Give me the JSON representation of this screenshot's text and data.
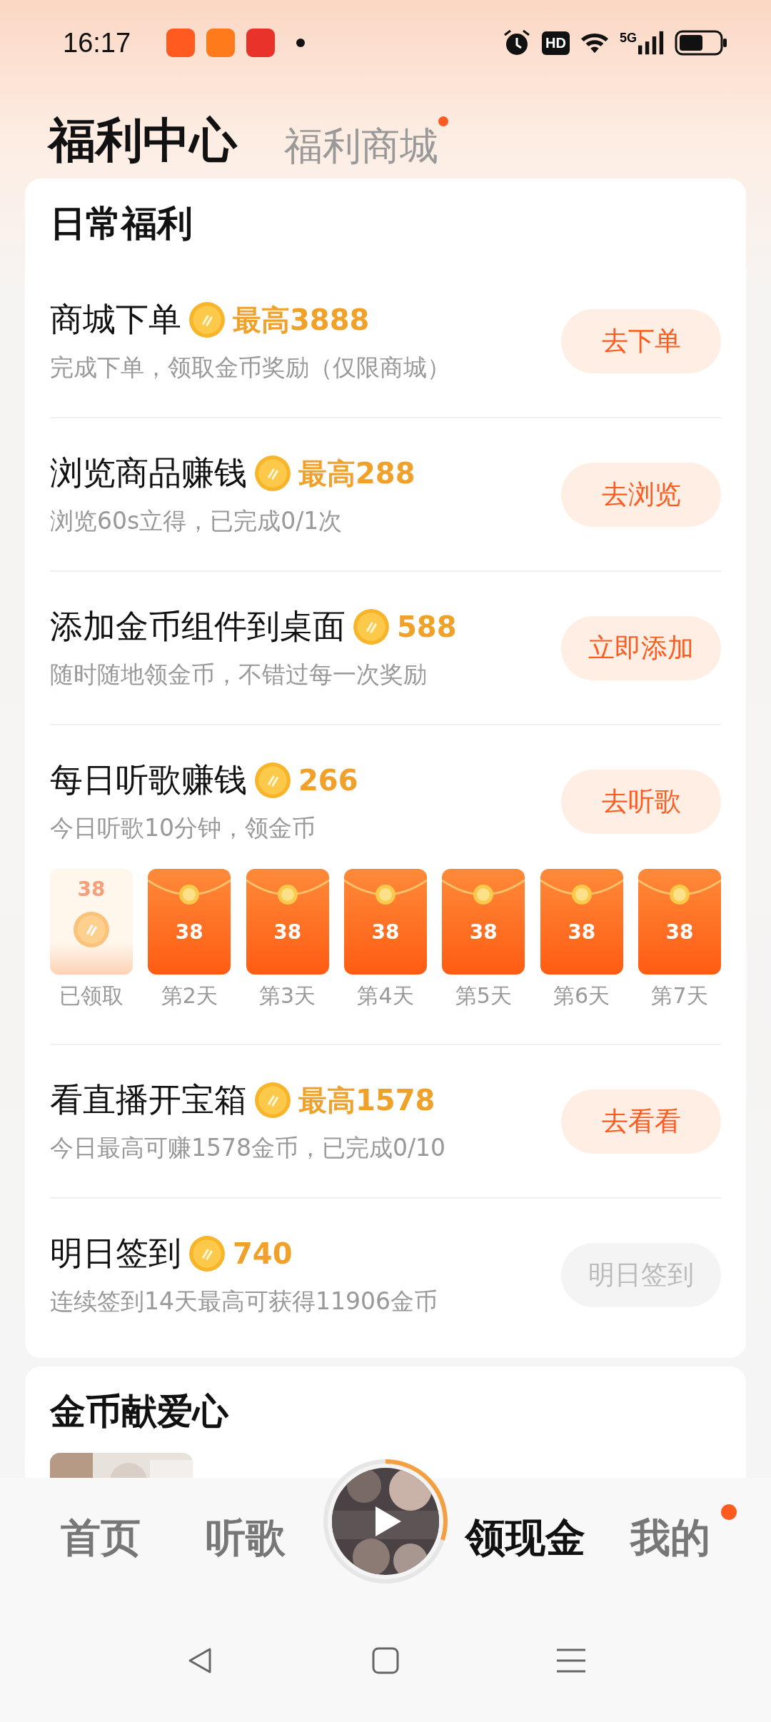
{
  "status_bar": {
    "time": "16:17",
    "notification_apps": [
      {
        "color": "#ff5a1f"
      },
      {
        "color": "#ff7a1a"
      },
      {
        "color": "#e8322a"
      }
    ],
    "hd": "HD",
    "network": "5G"
  },
  "tabs": [
    {
      "label": "福利中心",
      "selected": true,
      "badge": false
    },
    {
      "label": "福利商城",
      "selected": false,
      "badge": true
    }
  ],
  "daily": {
    "title": "日常福利",
    "tasks": [
      {
        "title": "商城下单",
        "reward": "最高3888",
        "subtitle": "完成下单，领取金币奖励（仅限商城）",
        "button": "去下单",
        "disabled": false
      },
      {
        "title": "浏览商品赚钱",
        "reward": "最高288",
        "subtitle": "浏览60s立得，已完成0/1次",
        "button": "去浏览",
        "disabled": false
      },
      {
        "title": "添加金币组件到桌面",
        "reward": "588",
        "subtitle": "随时随地领金币，不错过每一次奖励",
        "button": "立即添加",
        "disabled": false
      },
      {
        "title": "每日听歌赚钱",
        "reward": "266",
        "subtitle": "今日听歌10分钟，领金币",
        "button": "去听歌",
        "disabled": false,
        "packets": [
          {
            "amount": "38",
            "label": "已领取",
            "claimed": true
          },
          {
            "amount": "38",
            "label": "第2天",
            "claimed": false
          },
          {
            "amount": "38",
            "label": "第3天",
            "claimed": false
          },
          {
            "amount": "38",
            "label": "第4天",
            "claimed": false
          },
          {
            "amount": "38",
            "label": "第5天",
            "claimed": false
          },
          {
            "amount": "38",
            "label": "第6天",
            "claimed": false
          },
          {
            "amount": "38",
            "label": "第7天",
            "claimed": false
          }
        ]
      },
      {
        "title": "看直播开宝箱",
        "reward": "最高1578",
        "subtitle": "今日最高可赚1578金币，已完成0/10",
        "button": "去看看",
        "disabled": false
      },
      {
        "title": "明日签到",
        "reward": "740",
        "subtitle": "连续签到14天最高可获得11906金币",
        "button": "明日签到",
        "disabled": true
      }
    ]
  },
  "charity": {
    "title": "金币献爱心"
  },
  "bottom_nav": [
    {
      "kind": "tab",
      "label": "首页",
      "selected": false,
      "badge": false
    },
    {
      "kind": "tab",
      "label": "听歌",
      "selected": false,
      "badge": false
    },
    {
      "kind": "player"
    },
    {
      "kind": "tab",
      "label": "领现金",
      "selected": true,
      "badge": false
    },
    {
      "kind": "tab",
      "label": "我的",
      "selected": false,
      "badge": true
    }
  ]
}
